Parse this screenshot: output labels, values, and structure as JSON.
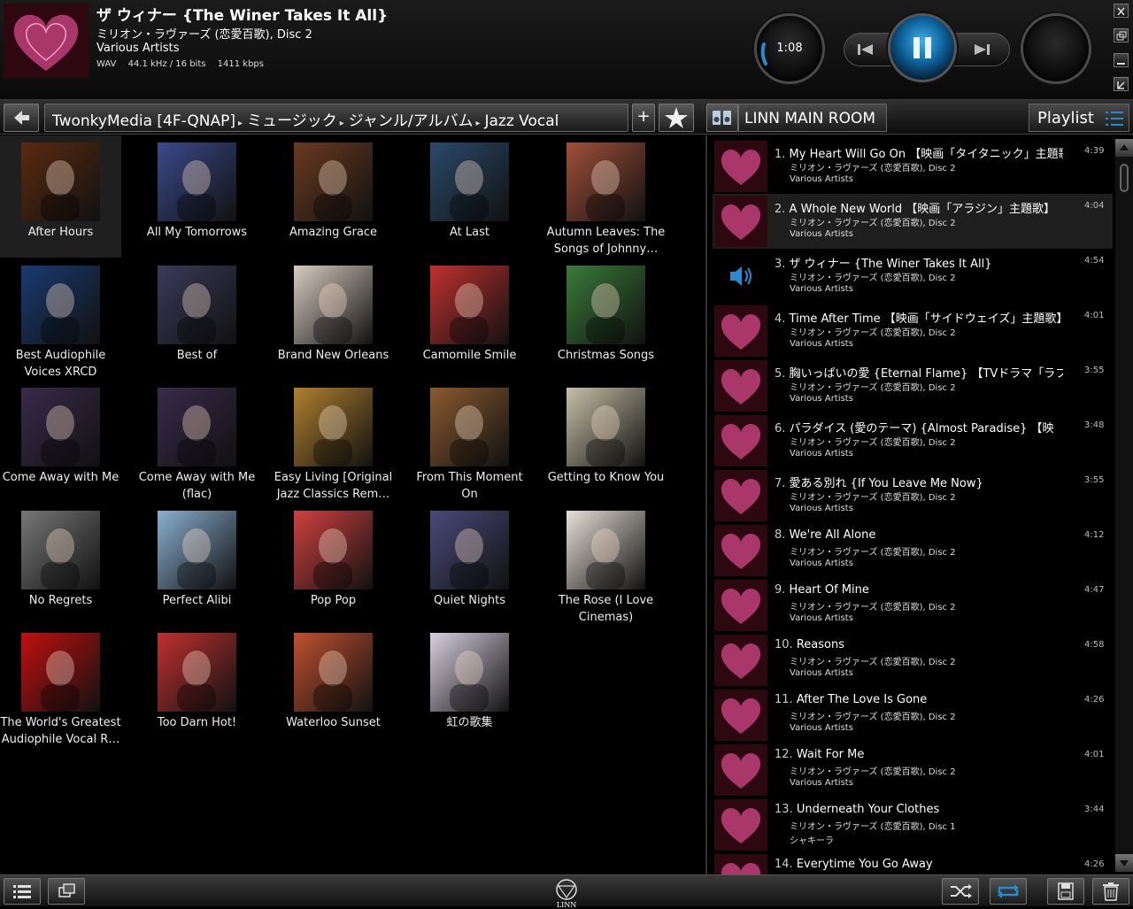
{
  "now_playing": {
    "title": "ザ ウィナー {The Winer Takes It All}",
    "album": "ミリオン・ラヴァーズ (恋愛百歌), Disc 2",
    "artist": "Various Artists",
    "format": "WAV",
    "sample_rate": "44.1 kHz / 16 bits",
    "bitrate": "1411 kbps",
    "elapsed": "1:08"
  },
  "nav": {
    "breadcrumb": [
      "TwonkyMedia [4F-QNAP]",
      "ミュージック",
      "ジャンル/アルバム",
      "Jazz Vocal"
    ],
    "add_label": "+",
    "room_name": "LINN MAIN ROOM",
    "playlist_label": "Playlist"
  },
  "albums": [
    {
      "label": "After Hours",
      "color": "#5a2a10"
    },
    {
      "label": "All My Tomorrows",
      "color": "#3a4a8a"
    },
    {
      "label": "Amazing Grace",
      "color": "#6a3a20"
    },
    {
      "label": "At Last",
      "color": "#2a4a6a"
    },
    {
      "label": "Autumn Leaves: The Songs of Johnny…",
      "color": "#a0503a"
    },
    {
      "label": "Best Audiophile Voices XRCD",
      "color": "#1a3a70"
    },
    {
      "label": "Best of",
      "color": "#3a3a5a"
    },
    {
      "label": "Brand New Orleans",
      "color": "#d8ccc0"
    },
    {
      "label": "Camomile Smile",
      "color": "#c03030"
    },
    {
      "label": "Christmas Songs",
      "color": "#3a7a3a"
    },
    {
      "label": "Come Away with Me",
      "color": "#3a2a4a"
    },
    {
      "label": "Come Away with Me (flac)",
      "color": "#3a2a4a"
    },
    {
      "label": "Easy Living [Original Jazz Classics Rem…",
      "color": "#b08030"
    },
    {
      "label": "From This Moment On",
      "color": "#8a5a30"
    },
    {
      "label": "Getting to Know You",
      "color": "#c8c0a8"
    },
    {
      "label": "No Regrets",
      "color": "#777777"
    },
    {
      "label": "Perfect Alibi",
      "color": "#8ab0d0"
    },
    {
      "label": "Pop Pop",
      "color": "#d04040"
    },
    {
      "label": "Quiet Nights",
      "color": "#4a4a7a"
    },
    {
      "label": "The Rose (I Love Cinemas)",
      "color": "#e8e0d8"
    },
    {
      "label": "The World's Greatest Audiophile Vocal R…",
      "color": "#c01010"
    },
    {
      "label": "Too Darn Hot!",
      "color": "#c03030"
    },
    {
      "label": "Waterloo Sunset",
      "color": "#c05030"
    },
    {
      "label": "虹の歌集",
      "color": "#d8d0e0"
    }
  ],
  "playlist": [
    {
      "num": "1.",
      "title": "My Heart Will Go On 【映画「タイタニック」主題歌】",
      "album": "ミリオン・ラヴァーズ (恋愛百歌), Disc 2",
      "artist": "Various Artists",
      "duration": "4:39"
    },
    {
      "num": "2.",
      "title": "A Whole New World 【映画「アラジン」主題歌】",
      "album": "ミリオン・ラヴァーズ (恋愛百歌), Disc 2",
      "artist": "Various Artists",
      "duration": "4:04"
    },
    {
      "num": "3.",
      "title": "ザ ウィナー {The Winer Takes It All}",
      "album": "ミリオン・ラヴァーズ (恋愛百歌), Disc 2",
      "artist": "Various Artists",
      "duration": "4:54"
    },
    {
      "num": "4.",
      "title": "Time After Time 【映画「サイドウェイズ」主題歌】",
      "album": "ミリオン・ラヴァーズ (恋愛百歌), Disc 2",
      "artist": "Various Artists",
      "duration": "4:01"
    },
    {
      "num": "5.",
      "title": "胸いっぱいの愛 {Eternal Flame} 【TVドラマ「ラブ",
      "album": "ミリオン・ラヴァーズ (恋愛百歌), Disc 2",
      "artist": "Various Artists",
      "duration": "3:55"
    },
    {
      "num": "6.",
      "title": "パラダイス (愛のテーマ) {Almost Paradise} 【映",
      "album": "ミリオン・ラヴァーズ (恋愛百歌), Disc 2",
      "artist": "Various Artists",
      "duration": "3:48"
    },
    {
      "num": "7.",
      "title": "愛ある別れ {If You Leave Me Now}",
      "album": "ミリオン・ラヴァーズ (恋愛百歌), Disc 2",
      "artist": "Various Artists",
      "duration": "3:55"
    },
    {
      "num": "8.",
      "title": "We're All Alone",
      "album": "ミリオン・ラヴァーズ (恋愛百歌), Disc 2",
      "artist": "Various Artists",
      "duration": "4:12"
    },
    {
      "num": "9.",
      "title": "Heart Of Mine",
      "album": "ミリオン・ラヴァーズ (恋愛百歌), Disc 2",
      "artist": "Various Artists",
      "duration": "4:47"
    },
    {
      "num": "10.",
      "title": "Reasons",
      "album": "ミリオン・ラヴァーズ (恋愛百歌), Disc 2",
      "artist": "Various Artists",
      "duration": "4:58"
    },
    {
      "num": "11.",
      "title": "After The Love Is Gone",
      "album": "ミリオン・ラヴァーズ (恋愛百歌), Disc 2",
      "artist": "Various Artists",
      "duration": "4:26"
    },
    {
      "num": "12.",
      "title": "Wait For Me",
      "album": "ミリオン・ラヴァーズ (恋愛百歌), Disc 2",
      "artist": "Various Artists",
      "duration": "4:01"
    },
    {
      "num": "13.",
      "title": "Underneath Your Clothes",
      "album": "ミリオン・ラヴァーズ (恋愛百歌), Disc 1",
      "artist": "シャキーラ",
      "duration": "3:44"
    },
    {
      "num": "14.",
      "title": "Everytime You Go Away",
      "album": "",
      "artist": "",
      "duration": "4:26"
    }
  ],
  "footer": {
    "logo_text": "LINN"
  },
  "colors": {
    "accent": "#2a8ad0",
    "highlight_row": "#1e1e1e"
  }
}
